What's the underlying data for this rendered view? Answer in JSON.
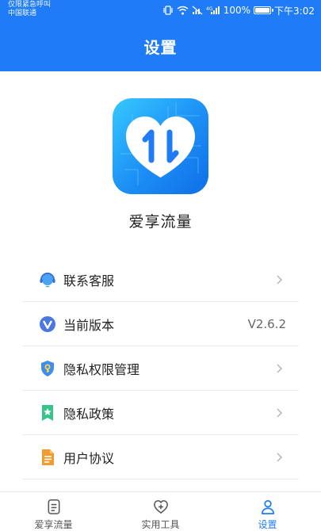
{
  "status_bar": {
    "carrier_line1": "仅限紧急呼叫",
    "carrier_line2": "中国联通",
    "battery_text": "100%",
    "battery_level": 1.0,
    "time": "下午3:02"
  },
  "header": {
    "title": "设置"
  },
  "app": {
    "name": "爱享流量",
    "icon": "heart-arrows-icon"
  },
  "menu": {
    "items": [
      {
        "label": "联系客服",
        "icon": "customer-service-icon"
      },
      {
        "label": "当前版本",
        "icon": "version-icon",
        "value": "V2.6.2"
      },
      {
        "label": "隐私权限管理",
        "icon": "shield-key-icon"
      },
      {
        "label": "隐私政策",
        "icon": "star-document-icon"
      },
      {
        "label": "用户协议",
        "icon": "document-icon"
      }
    ]
  },
  "bottom_nav": {
    "tabs": [
      {
        "label": "爱享流量",
        "icon": "document-icon"
      },
      {
        "label": "实用工具",
        "icon": "heart-plus-icon"
      },
      {
        "label": "设置",
        "icon": "user-icon",
        "active": true
      }
    ]
  },
  "colors": {
    "primary": "#1f7cf6",
    "background": "#ffffff",
    "divider": "#ececec"
  }
}
